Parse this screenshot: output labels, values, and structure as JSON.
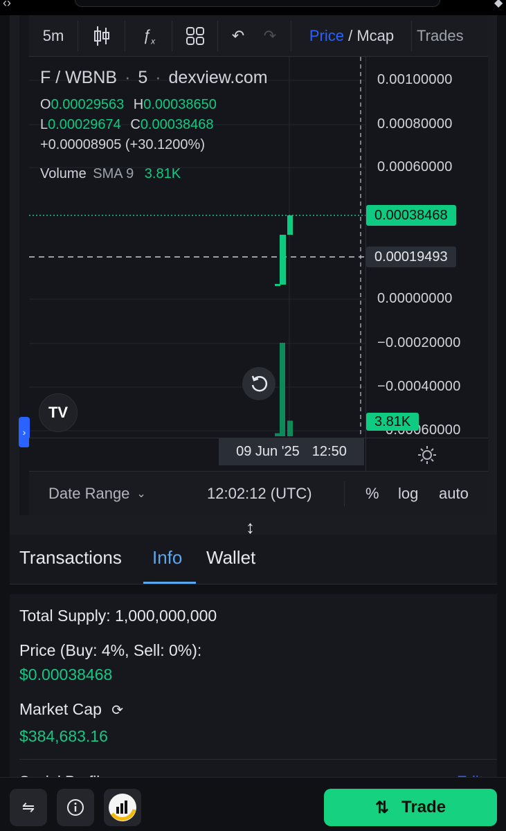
{
  "toolbar": {
    "interval": "5m",
    "price_label": "Price",
    "separator": " / ",
    "mcap_label": "Mcap",
    "trades_label": "Trades"
  },
  "legend": {
    "symbol": "F / WBNB",
    "interval": "5",
    "source": "dexview.com",
    "open_key": "O",
    "open": "0.00029563",
    "high_key": "H",
    "high": "0.00038650",
    "low_key": "L",
    "low": "0.00029674",
    "close_key": "C",
    "close": "0.00038468",
    "change": "+0.00008905 (+30.1200%)",
    "volume_label": "Volume",
    "sma_label": "SMA 9",
    "volume_value": "3.81K"
  },
  "price_axis": {
    "labels": [
      "0.00100000",
      "0.00080000",
      "0.00060000",
      "0.00000000",
      "−0.00020000",
      "−0.00040000",
      "−0.00060000"
    ],
    "last_price": "0.00038468",
    "crosshair_price": "0.00019493",
    "volume_tag": "3.81K"
  },
  "chart_data": {
    "type": "bar",
    "candles": [
      {
        "open": 0.00015,
        "high": 0.00016,
        "low": 0.00015,
        "close": 0.00016
      },
      {
        "open": 0.00016,
        "high": 0.0003,
        "low": 0.00016,
        "close": 0.0003
      },
      {
        "open": 0.00029563,
        "high": 0.0003865,
        "low": 0.00029674,
        "close": 0.00038468
      }
    ],
    "volumes": [
      0.1,
      3.0,
      0.5
    ],
    "ylim": [
      -0.0006,
      0.001
    ]
  },
  "time_axis": {
    "date": "09 Jun '25",
    "time": "12:50"
  },
  "bottom_bar": {
    "date_range": "Date Range",
    "clock": "12:02:12 (UTC)",
    "percent": "%",
    "log": "log",
    "auto": "auto"
  },
  "tabs": [
    "Transactions",
    "Info",
    "Wallet"
  ],
  "info": {
    "total_supply": "Total Supply: 1,000,000,000",
    "price_label": "Price (Buy: 4%, Sell: 0%):",
    "price_value": "$0.00038468",
    "market_cap_label": "Market Cap",
    "market_cap_value": "$384,683.16",
    "next_section": "Social Profiles",
    "next_action": "Edit"
  },
  "footer": {
    "trade_label": "Trade"
  },
  "colors": {
    "up": "#0ecb81",
    "accent": "#2962ff",
    "tab_active": "#5aa7ee",
    "trade_button": "#16d17f"
  }
}
